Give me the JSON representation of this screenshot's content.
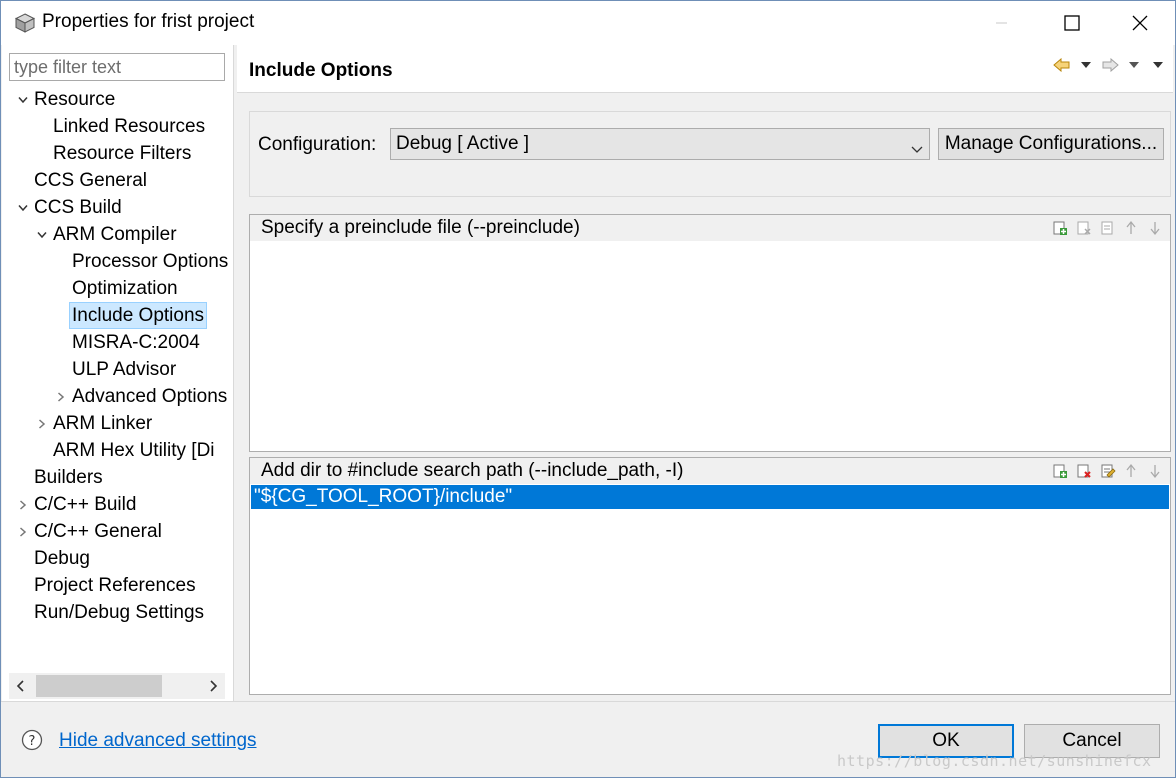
{
  "window": {
    "title": "Properties for frist project",
    "icon": "package-cube-icon"
  },
  "left": {
    "filter_placeholder": "type filter text",
    "tree": [
      {
        "label": "Resource",
        "depth": 0,
        "expander": "expanded"
      },
      {
        "label": "Linked Resources",
        "depth": 1,
        "expander": "none"
      },
      {
        "label": "Resource Filters",
        "depth": 1,
        "expander": "none"
      },
      {
        "label": "CCS General",
        "depth": 0,
        "expander": "none"
      },
      {
        "label": "CCS Build",
        "depth": 0,
        "expander": "expanded"
      },
      {
        "label": "ARM Compiler",
        "depth": 1,
        "expander": "expanded"
      },
      {
        "label": "Processor Options",
        "depth": 2,
        "expander": "none"
      },
      {
        "label": "Optimization",
        "depth": 2,
        "expander": "none"
      },
      {
        "label": "Include Options",
        "depth": 2,
        "expander": "none",
        "selected": true
      },
      {
        "label": "MISRA-C:2004",
        "depth": 2,
        "expander": "none"
      },
      {
        "label": "ULP Advisor",
        "depth": 2,
        "expander": "none"
      },
      {
        "label": "Advanced Options",
        "depth": 2,
        "expander": "collapsed"
      },
      {
        "label": "ARM Linker",
        "depth": 1,
        "expander": "collapsed"
      },
      {
        "label": "ARM Hex Utility  [Di",
        "depth": 1,
        "expander": "none"
      },
      {
        "label": "Builders",
        "depth": 0,
        "expander": "none"
      },
      {
        "label": "C/C++ Build",
        "depth": 0,
        "expander": "collapsed"
      },
      {
        "label": "C/C++ General",
        "depth": 0,
        "expander": "collapsed"
      },
      {
        "label": "Debug",
        "depth": 0,
        "expander": "none"
      },
      {
        "label": "Project References",
        "depth": 0,
        "expander": "none"
      },
      {
        "label": "Run/Debug Settings",
        "depth": 0,
        "expander": "none"
      }
    ]
  },
  "right": {
    "page_title": "Include Options",
    "config_label": "Configuration:",
    "config_value": "Debug  [ Active ]",
    "manage_button": "Manage Configurations...",
    "preinclude_title": "Specify a preinclude file (--preinclude)",
    "preinclude_items": [],
    "include_path_title": "Add dir to #include search path (--include_path, -I)",
    "include_path_items": [
      "\"${CG_TOOL_ROOT}/include\""
    ]
  },
  "bottom": {
    "hide_link": "Hide advanced settings",
    "ok_label": "OK",
    "cancel_label": "Cancel",
    "watermark": "https://blog.csdn.net/sunshinefcx"
  },
  "colors": {
    "selection_blue": "#0078d7",
    "tree_selection": "#cce8ff",
    "link": "#0066cc"
  }
}
